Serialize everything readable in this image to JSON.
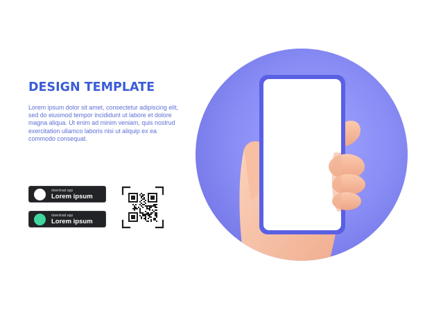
{
  "header": {
    "title": "DESIGN TEMPLATE"
  },
  "description": {
    "text": "Lorem ipsum dolor sit amet, consectetur adipiscing elit, sed do eiusmod tempor incididunt ut labore et dolore magna aliqua. Ut enim ad minim veniam, quis nostrud exercitation ullamco laboris nisi ut aliquip ex ea commodo consequat."
  },
  "download_buttons": [
    {
      "caption": "download app",
      "label": "Lorem ipsum",
      "dot_color": "#ffffff"
    },
    {
      "caption": "download app",
      "label": "Lorem ipsum",
      "dot_color": "#3fd6a0"
    }
  ],
  "qr_code": {
    "icon": "qr-code-icon"
  },
  "illustration": {
    "icon": "hand-holding-phone-icon",
    "circle_color": "#8a8ef5",
    "phone_frame_color": "#5a60e3",
    "phone_screen_color": "#ffffff",
    "hand_color": "#f7c3a8"
  },
  "colors": {
    "accent": "#3b5bd6",
    "text": "#5d6fd6",
    "button_bg": "#222326"
  }
}
